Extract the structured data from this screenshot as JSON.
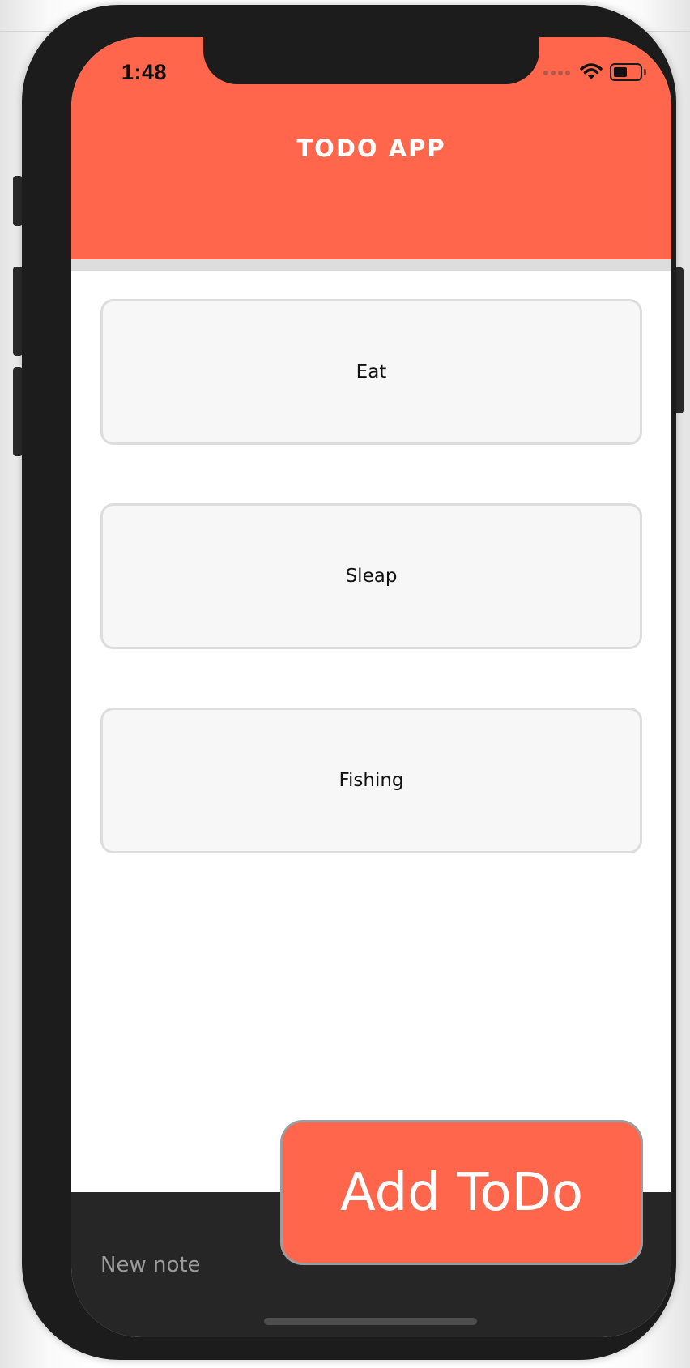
{
  "status_bar": {
    "time": "1:48"
  },
  "header": {
    "title": "TODO APP"
  },
  "todos": [
    {
      "label": "Eat"
    },
    {
      "label": "Sleap"
    },
    {
      "label": "Fishing"
    }
  ],
  "composer": {
    "placeholder": "New note",
    "add_button_label": "Add ToDo"
  },
  "colors": {
    "accent": "#FF664B",
    "phone_frame": "#1c1c1c",
    "bottom_bar": "#262626",
    "card_background": "#f7f7f7",
    "card_border": "#dddddd"
  },
  "icons": [
    "cellular-signal-icon",
    "wifi-icon",
    "battery-icon"
  ]
}
